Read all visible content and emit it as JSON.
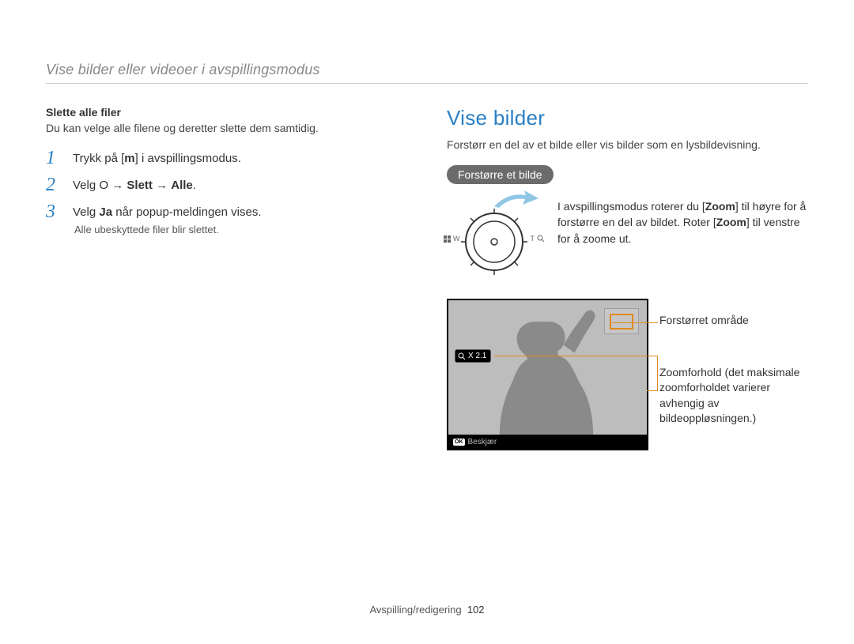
{
  "breadcrumb": "Vise bilder eller videoer i avspillingsmodus",
  "left": {
    "subhead": "Slette alle filer",
    "intro": "Du kan velge alle filene og deretter slette dem samtidig.",
    "steps": [
      {
        "num": "1",
        "prefix": "Trykk på [",
        "key": "m",
        "suffix": "] i avspillingsmodus."
      },
      {
        "num": "2",
        "prefix": "Velg ",
        "icon": "O",
        "arrow1": " → ",
        "b1": "Slett",
        "arrow2": " → ",
        "b2": "Alle",
        "suffix": "."
      },
      {
        "num": "3",
        "prefix": "Velg ",
        "b1": "Ja",
        "suffix": " når popup-meldingen vises.",
        "note": "Alle ubeskyttede filer blir slettet."
      }
    ]
  },
  "right": {
    "title": "Vise bilder",
    "intro": "Forstørr en del av et bilde eller vis bilder som en lysbildevisning.",
    "pill": "Forstørre et bilde",
    "zoom_annotation_left": "W",
    "zoom_annotation_right": "T",
    "zoom_text_pre": "I avspillingsmodus roterer du [",
    "zoom_word": "Zoom",
    "zoom_text_mid": "] til høyre for å forstørre en del av bildet. Roter [",
    "zoom_text_post": "] til venstre for å zoome ut.",
    "preview": {
      "zoom_badge": "X 2.1",
      "bottom_label": "Beskjær"
    },
    "callout1": "Forstørret område",
    "callout2": "Zoomforhold (det maksimale zoomforholdet varierer avhengig av bildeoppløsningen.)"
  },
  "footer": {
    "section": "Avspilling/redigering",
    "page": "102"
  }
}
